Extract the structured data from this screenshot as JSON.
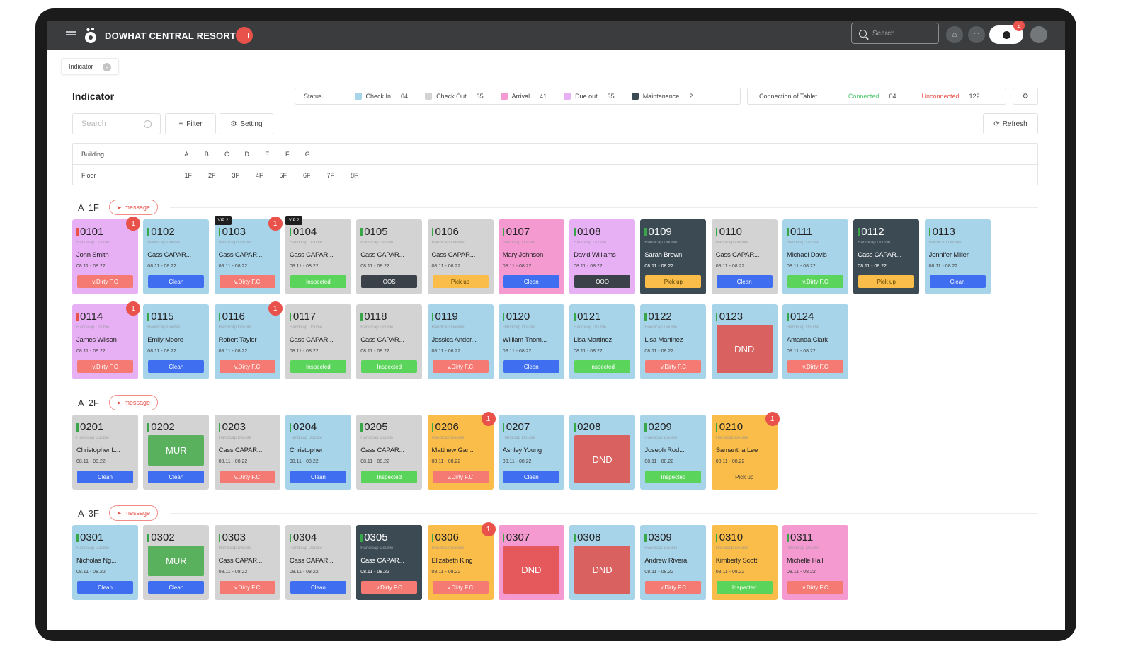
{
  "app": {
    "name": "DOWHAT CENTRAL RESORT",
    "search_placeholder": "Search",
    "notif_count": "2"
  },
  "page": {
    "tab_label": "Indicator",
    "tab_close": "×",
    "title": "Indicator",
    "search_placeholder": "Search",
    "filter_label": "Filter",
    "setting_label": "Setting",
    "refresh_label": "Refresh",
    "settings_icon_text": "⚙"
  },
  "status": {
    "label": "Status",
    "items": [
      {
        "label": "Check In",
        "count": "04",
        "color": "#a8d4ea"
      },
      {
        "label": "Check Out",
        "count": "65",
        "color": "#d3d3d3"
      },
      {
        "label": "Arrival",
        "count": "41",
        "color": "#f59ad0"
      },
      {
        "label": "Due out",
        "count": "35",
        "color": "#e8b0f4"
      },
      {
        "label": "Maintenance",
        "count": "2",
        "color": "#3c4a54"
      }
    ]
  },
  "tablet": {
    "label": "Connection of Tablet",
    "connected_label": "Connected",
    "connected_count": "04",
    "unconnected_label": "Unconnected",
    "unconnected_count": "122"
  },
  "filters": {
    "building_label": "Building",
    "buildings": [
      "A",
      "B",
      "C",
      "D",
      "E",
      "F",
      "G"
    ],
    "floor_label": "Floor",
    "floors": [
      "1F",
      "2F",
      "3F",
      "4F",
      "5F",
      "6F",
      "7F",
      "8F"
    ]
  },
  "sections": [
    {
      "building": "A",
      "floor": "1F",
      "message_label": "message",
      "rows": [
        [
          {
            "no": "0101",
            "type": "Handicap Double",
            "guest": "John Smith",
            "dates": "08.11 - 08.22",
            "status": "v.Dirty F.C",
            "bg": "#e8b0f4",
            "badge": "1",
            "red": true
          },
          {
            "no": "0102",
            "type": "Handicap Double",
            "guest": "Cass CAPAR...",
            "dates": "08.11 - 08.22",
            "status": "Clean",
            "bg": "#a8d4ea"
          },
          {
            "no": "0103",
            "type": "Handicap Double",
            "guest": "Cass CAPAR...",
            "dates": "08.11 - 08.22",
            "status": "v.Dirty F.C",
            "bg": "#a8d4ea",
            "badge": "1",
            "vip": "VIP 2"
          },
          {
            "no": "0104",
            "type": "Handicap Double",
            "guest": "Cass CAPAR...",
            "dates": "08.11 - 08.22",
            "status": "Inspected",
            "bg": "#d3d3d3",
            "vip": "VIP 2"
          },
          {
            "no": "0105",
            "type": "Handicap Double",
            "guest": "Cass CAPAR...",
            "dates": "08.11 - 08.22",
            "status": "OOS",
            "bg": "#d3d3d3"
          },
          {
            "no": "0106",
            "type": "Handicap Double",
            "guest": "Cass CAPAR...",
            "dates": "08.11 - 08.22",
            "status": "Pick up",
            "bg": "#d3d3d3"
          },
          {
            "no": "0107",
            "type": "Handicap Double",
            "guest": "Mary Johnson",
            "dates": "08.11 - 08.22",
            "status": "Clean",
            "bg": "#f59ad0"
          },
          {
            "no": "0108",
            "type": "Handicap Double",
            "guest": "David Williams",
            "dates": "08.11 - 08.22",
            "status": "OOO",
            "bg": "#e8b0f4"
          },
          {
            "no": "0109",
            "type": "Handicap Double",
            "guest": "Sarah Brown",
            "dates": "08.11 - 08.22",
            "status": "Pick up",
            "bg": "#3c4a54",
            "dark": true
          },
          {
            "no": "0110",
            "type": "Handicap Double",
            "guest": "Cass CAPAR...",
            "dates": "08.11 - 08.22",
            "status": "Clean",
            "bg": "#d3d3d3"
          },
          {
            "no": "0111",
            "type": "Handicap Double",
            "guest": "Michael Davis",
            "dates": "08.11 - 08.22",
            "status": "v.Dirty F.C",
            "bg": "#a8d4ea",
            "status_color": "#5bd45b"
          },
          {
            "no": "0112",
            "type": "Handicap Double",
            "guest": "Cass CAPAR...",
            "dates": "08.11 - 08.22",
            "status": "Pick up",
            "bg": "#3c4a54",
            "dark": true
          },
          {
            "no": "0113",
            "type": "Handicap Double",
            "guest": "Jennifer Miller",
            "dates": "08.11 - 08.22",
            "status": "Clean",
            "bg": "#a8d4ea"
          }
        ],
        [
          {
            "no": "0114",
            "type": "Handicap Double",
            "guest": "James Wilson",
            "dates": "08.11 - 08.22",
            "status": "v.Dirty F.C",
            "bg": "#e8b0f4",
            "badge": "1",
            "red": true
          },
          {
            "no": "0115",
            "type": "Handicap Double",
            "guest": "Emily Moore",
            "dates": "08.11 - 08.22",
            "status": "Clean",
            "bg": "#a8d4ea"
          },
          {
            "no": "0116",
            "type": "Handicap Double",
            "guest": "Robert Taylor",
            "dates": "08.11 - 08.22",
            "status": "v.Dirty F.C",
            "bg": "#a8d4ea",
            "badge": "1"
          },
          {
            "no": "0117",
            "type": "Handicap Double",
            "guest": "Cass CAPAR...",
            "dates": "08.11 - 08.22",
            "status": "Inspected",
            "bg": "#d3d3d3"
          },
          {
            "no": "0118",
            "type": "Handicap Double",
            "guest": "Cass CAPAR...",
            "dates": "08.11 - 08.22",
            "status": "Inspected",
            "bg": "#d3d3d3"
          },
          {
            "no": "0119",
            "type": "Handicap Double",
            "guest": "Jessica Ander...",
            "dates": "08.11 - 08.22",
            "status": "v.Dirty F.C",
            "bg": "#a8d4ea"
          },
          {
            "no": "0120",
            "type": "Handicap Double",
            "guest": "William Thom...",
            "dates": "08.11 - 08.22",
            "status": "Clean",
            "bg": "#a8d4ea"
          },
          {
            "no": "0121",
            "type": "Handicap Double",
            "guest": "Lisa Martinez",
            "dates": "08.11 - 08.22",
            "status": "Inspected",
            "bg": "#a8d4ea"
          },
          {
            "no": "0122",
            "type": "Handicap Double",
            "guest": "Lisa Martinez",
            "dates": "08.11 - 08.22",
            "status": "v.Dirty F.C",
            "bg": "#a8d4ea"
          },
          {
            "no": "0123",
            "type": "",
            "guest": "",
            "dates": "",
            "status": "",
            "bg": "#a8d4ea",
            "overlay": "DND",
            "hide_status": true
          },
          {
            "no": "0124",
            "type": "Handicap Double",
            "guest": "Amanda Clark",
            "dates": "08.11 - 08.22",
            "status": "v.Dirty F.C",
            "bg": "#a8d4ea"
          }
        ]
      ]
    },
    {
      "building": "A",
      "floor": "2F",
      "message_label": "message",
      "rows": [
        [
          {
            "no": "0201",
            "type": "Handicap Double",
            "guest": "Christopher L...",
            "dates": "08.11 - 08.22",
            "status": "Clean",
            "bg": "#d3d3d3"
          },
          {
            "no": "0202",
            "type": "",
            "guest": "",
            "dates": "",
            "status": "Clean",
            "bg": "#d3d3d3",
            "overlay": "MUR"
          },
          {
            "no": "0203",
            "type": "Handicap Double",
            "guest": "Cass CAPAR...",
            "dates": "08.11 - 08.22",
            "status": "v.Dirty F.C",
            "bg": "#d3d3d3"
          },
          {
            "no": "0204",
            "type": "Handicap Double",
            "guest": "Christopher",
            "dates": "08.11 - 08.22",
            "status": "Clean",
            "bg": "#a8d4ea"
          },
          {
            "no": "0205",
            "type": "Handicap Double",
            "guest": "Cass CAPAR...",
            "dates": "08.11 - 08.22",
            "status": "Inspected",
            "bg": "#d3d3d3"
          },
          {
            "no": "0206",
            "type": "Handicap Double",
            "guest": "Matthew Gar...",
            "dates": "08.11 - 08.22",
            "status": "v.Dirty F.C",
            "bg": "#fbbd4a",
            "badge": "1"
          },
          {
            "no": "0207",
            "type": "Handicap Double",
            "guest": "Ashley Young",
            "dates": "08.11 - 08.22",
            "status": "Clean",
            "bg": "#a8d4ea"
          },
          {
            "no": "0208",
            "type": "",
            "guest": "",
            "dates": "",
            "status": "",
            "bg": "#a8d4ea",
            "overlay": "DND",
            "hide_status": true
          },
          {
            "no": "0209",
            "type": "Handicap Double",
            "guest": "Joseph Rod...",
            "dates": "08.11 - 08.22",
            "status": "Inspected",
            "bg": "#a8d4ea"
          },
          {
            "no": "0210",
            "type": "Handicap Double",
            "guest": "Samantha Lee",
            "dates": "08.11 - 08.22",
            "status": "Pick up",
            "bg": "#fbbd4a",
            "badge": "1",
            "plain": true
          }
        ]
      ]
    },
    {
      "building": "A",
      "floor": "3F",
      "message_label": "message",
      "rows": [
        [
          {
            "no": "0301",
            "type": "Handicap Double",
            "guest": "Nicholas Ng...",
            "dates": "08.11 - 08.22",
            "status": "Clean",
            "bg": "#a8d4ea"
          },
          {
            "no": "0302",
            "type": "",
            "guest": "",
            "dates": "",
            "status": "Clean",
            "bg": "#d3d3d3",
            "overlay": "MUR"
          },
          {
            "no": "0303",
            "type": "Handicap Double",
            "guest": "Cass CAPAR...",
            "dates": "08.11 - 08.22",
            "status": "v.Dirty F.C",
            "bg": "#d3d3d3"
          },
          {
            "no": "0304",
            "type": "Handicap Double",
            "guest": "Cass CAPAR...",
            "dates": "08.11 - 08.22",
            "status": "Clean",
            "bg": "#d3d3d3"
          },
          {
            "no": "0305",
            "type": "Handicap Double",
            "guest": "Cass CAPAR...",
            "dates": "08.11 - 08.22",
            "status": "v.Dirty F.C",
            "bg": "#3c4a54",
            "dark": true
          },
          {
            "no": "0306",
            "type": "Handicap Double",
            "guest": "Elizabeth King",
            "dates": "08.11 - 08.22",
            "status": "v.Dirty F.C",
            "bg": "#fbbd4a",
            "badge": "1"
          },
          {
            "no": "0307",
            "type": "",
            "guest": "",
            "dates": "",
            "status": "",
            "bg": "#f59ad0",
            "overlay": "DND",
            "hide_status": true
          },
          {
            "no": "0308",
            "type": "",
            "guest": "",
            "dates": "",
            "status": "",
            "bg": "#a8d4ea",
            "overlay": "DND",
            "hide_status": true
          },
          {
            "no": "0309",
            "type": "Handicap Double",
            "guest": "Andrew Rivera",
            "dates": "08.11 - 08.22",
            "status": "v.Dirty F.C",
            "bg": "#a8d4ea"
          },
          {
            "no": "0310",
            "type": "Handicap Double",
            "guest": "Kimberly Scott",
            "dates": "08.11 - 08.22",
            "status": "Inspected",
            "bg": "#fbbd4a"
          },
          {
            "no": "0311",
            "type": "Handicap Double",
            "guest": "Michelle Hall",
            "dates": "08.11 - 08.22",
            "status": "v.Dirty F.C",
            "bg": "#f59ad0"
          }
        ]
      ]
    }
  ],
  "status_colors": {
    "Clean": "#3f6ff0",
    "v.Dirty F.C": "#f47a73",
    "Inspected": "#5bd45b",
    "OOS": "#3a4148",
    "OOO": "#3a4148",
    "Pick up": "#fbbd4a"
  }
}
